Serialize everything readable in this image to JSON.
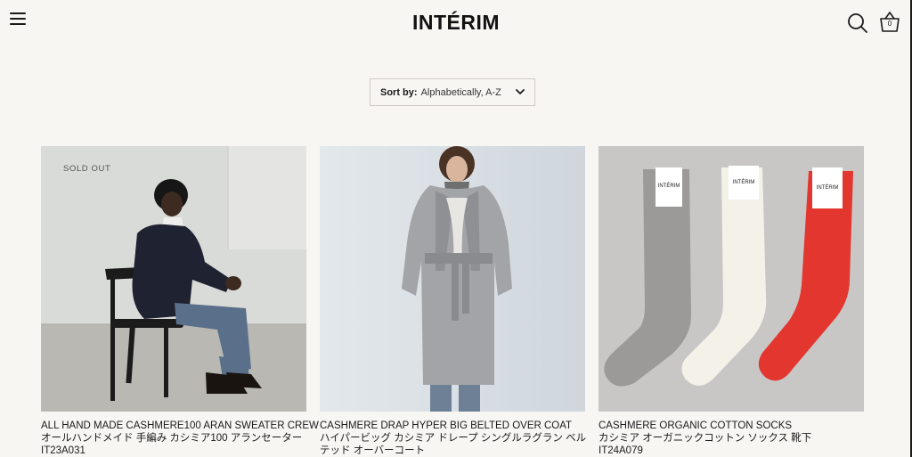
{
  "header": {
    "logo": "INTÉRIM",
    "cart_count": "0"
  },
  "sort": {
    "label": "Sort by:",
    "value": "Alphabetically, A-Z"
  },
  "products": [
    {
      "badge": "SOLD OUT",
      "title_en": "ALL HAND MADE CASHMERE100 ARAN SWEATER CREW",
      "title_jp": "オールハンドメイド 手編み カシミア100 アランセーター",
      "code": "IT23A031"
    },
    {
      "title_en": "CASHMERE DRAP HYPER BIG BELTED OVER COAT",
      "title_jp": "ハイパービッグ カシミア ドレープ シングルラグラン ベル",
      "title_jp2": "テッド オーバーコート"
    },
    {
      "title_en": "CASHMERE ORGANIC COTTON SOCKS",
      "title_jp": "カシミア オーガニックコットン ソックス 靴下",
      "code": "IT24A079",
      "sock_tag": "INTÉRIM"
    }
  ],
  "colors": {
    "background": "#f8f6f3",
    "sock_grey": "#9c9a98",
    "sock_white": "#f4f1e9",
    "sock_red": "#e2362f"
  }
}
